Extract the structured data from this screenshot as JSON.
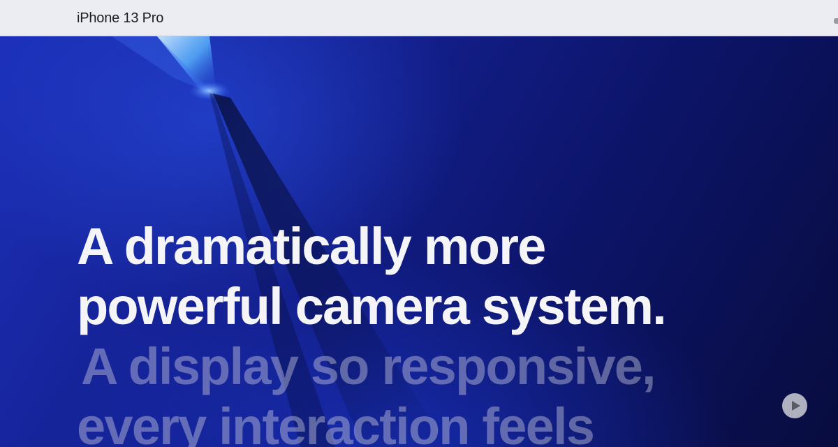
{
  "localnav": {
    "title": "iPhone 13 Pro"
  },
  "hero": {
    "headlines": [
      "A dramatically more",
      "powerful camera system.",
      "A display so responsive,",
      "every interaction feels"
    ],
    "play_button_icon": "play-icon"
  },
  "colors": {
    "nav_background": "#ecedf2",
    "headline_active": "#f5f5f7",
    "headline_inactive": "#9ea0b8",
    "hero_blue": "#14208f"
  }
}
